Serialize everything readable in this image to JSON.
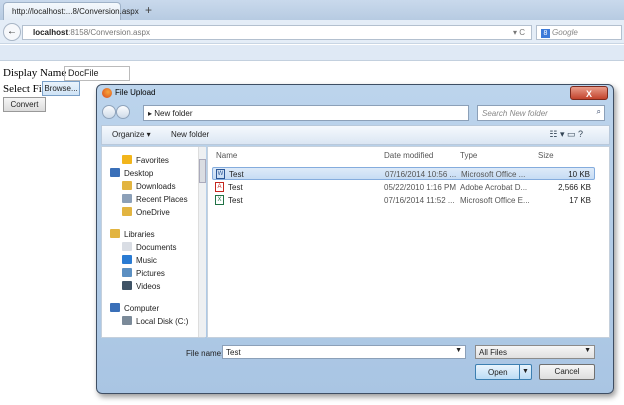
{
  "browser": {
    "tab_title": "http://localhost:...8/Conversion.aspx",
    "new_tab": "+",
    "url_host": "localhost",
    "url_rest": ":8158/Conversion.aspx",
    "url_icons": "▾ C",
    "search_engine_label": "8",
    "search_placeholder": "Google"
  },
  "page": {
    "display_name_label": "Display Name",
    "display_name_value": "DocFile",
    "select_file_label": "Select File",
    "browse_label": "Browse...",
    "convert_label": "Convert"
  },
  "dialog": {
    "title": "File Upload",
    "close": "X",
    "path": "▸ New folder",
    "search_placeholder": "Search New folder",
    "toolbar": {
      "organize": "Organize ▾",
      "new_folder": "New folder",
      "view_icons": "☷ ▾  ▭  ?"
    },
    "nav": [
      {
        "label": "Favorites",
        "color": "#f2b51b"
      },
      {
        "label": "Desktop",
        "color": "#3a6fb8"
      },
      {
        "label": "Downloads",
        "color": "#e2b440"
      },
      {
        "label": "Recent Places",
        "color": "#8ca0b8"
      },
      {
        "label": "OneDrive",
        "color": "#e2b440"
      },
      {
        "label": "Libraries",
        "color": "#e2b440"
      },
      {
        "label": "Documents",
        "color": "#d9dde4"
      },
      {
        "label": "Music",
        "color": "#2a7bd3"
      },
      {
        "label": "Pictures",
        "color": "#5b8fc2"
      },
      {
        "label": "Videos",
        "color": "#3f5366"
      },
      {
        "label": "Computer",
        "color": "#3a6fb8"
      },
      {
        "label": "Local Disk (C:)",
        "color": "#7b8a99"
      }
    ],
    "columns": {
      "name": "Name",
      "date": "Date modified",
      "type": "Type",
      "size": "Size"
    },
    "files": [
      {
        "name": "Test",
        "date": "07/16/2014 10:56 ...",
        "type": "Microsoft Office ...",
        "size": "10 KB",
        "icon": "W",
        "color": "#2b5797"
      },
      {
        "name": "Test",
        "date": "05/22/2010 1:16 PM",
        "type": "Adobe Acrobat D...",
        "size": "2,566 KB",
        "icon": "A",
        "color": "#c4261d"
      },
      {
        "name": "Test",
        "date": "07/16/2014 11:52 ...",
        "type": "Microsoft Office E...",
        "size": "17 KB",
        "icon": "X",
        "color": "#207245"
      }
    ],
    "file_name_label": "File name:",
    "file_name_value": "Test",
    "filter": "All Files",
    "open": "Open",
    "cancel": "Cancel"
  }
}
